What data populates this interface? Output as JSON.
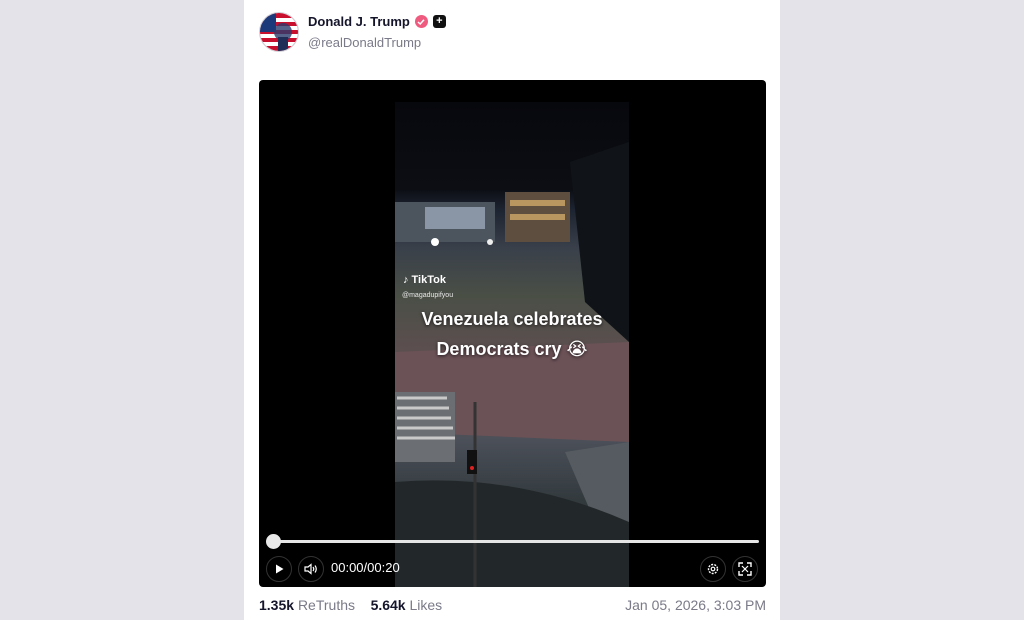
{
  "post": {
    "author_name": "Donald J. Trump",
    "handle": "@realDonaldTrump",
    "verified_icon": "verified-icon",
    "plus_icon": "plus-badge-icon"
  },
  "video": {
    "watermark": "TikTok",
    "watermark_user": "@magadupifyou",
    "caption_line1": "Venezuela celebrates",
    "caption_line2": "Democrats cry 😭",
    "current_time": "00:00",
    "time_separator": "/",
    "duration": "00:20",
    "progress": 0
  },
  "stats": {
    "retruths_count": "1.35k",
    "retruths_label": "ReTruths",
    "likes_count": "5.64k",
    "likes_label": "Likes",
    "timestamp": "Jan 05, 2026, 3:03 PM"
  },
  "colors": {
    "page_bg": "#e4e3e9",
    "card_bg": "#ffffff",
    "verified_badge": "#ee5b7f"
  }
}
